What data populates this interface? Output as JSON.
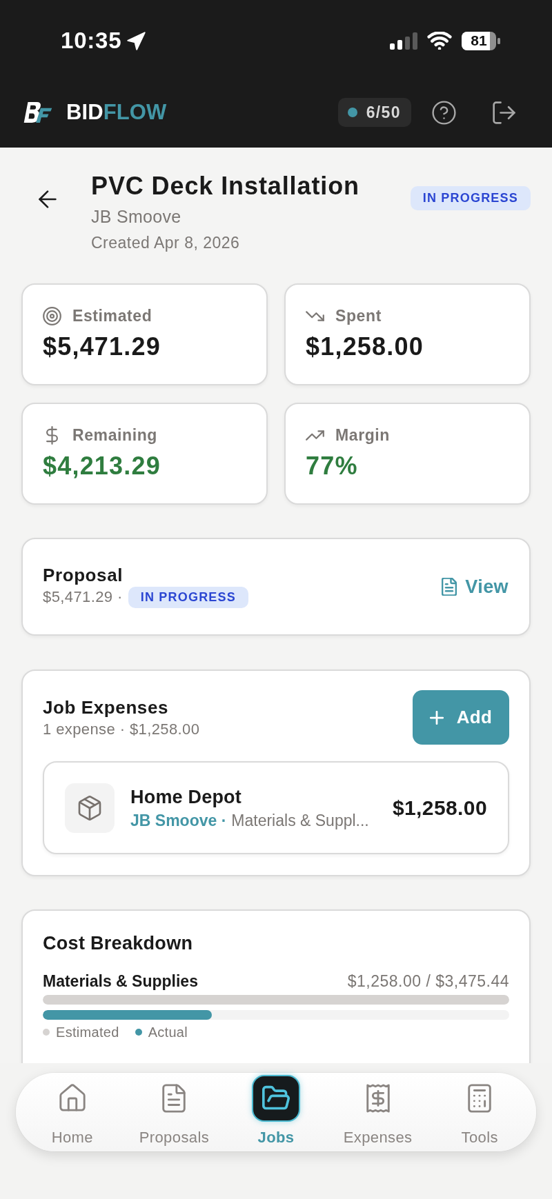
{
  "status_bar": {
    "time": "10:35",
    "battery": "81"
  },
  "header": {
    "brand": {
      "primary": "BID",
      "accent": "FLOW"
    },
    "usage": "6/50"
  },
  "job": {
    "title": "PVC Deck Installation",
    "client": "JB Smoove",
    "created": "Created Apr 8, 2026",
    "status": "IN PROGRESS"
  },
  "stats": [
    {
      "kind": "target",
      "label": "Estimated",
      "value": "$5,471.29",
      "positive": false
    },
    {
      "kind": "trend_down",
      "label": "Spent",
      "value": "$1,258.00",
      "positive": false
    },
    {
      "kind": "dollar",
      "label": "Remaining",
      "value": "$4,213.29",
      "positive": true
    },
    {
      "kind": "trend_up",
      "label": "Margin",
      "value": "77%",
      "positive": true
    }
  ],
  "proposal": {
    "title": "Proposal",
    "amount": "$5,471.29",
    "separator": "·",
    "status": "IN PROGRESS",
    "action": "View"
  },
  "expenses": {
    "title": "Job Expenses",
    "summary": "1 expense · $1,258.00",
    "add_label": "Add",
    "items": [
      {
        "vendor": "Home Depot",
        "client": "JB Smoove",
        "separator": "·",
        "category": "Materials & Suppl...",
        "amount": "$1,258.00"
      }
    ]
  },
  "cost_breakdown": {
    "title": "Cost Breakdown",
    "categories": [
      {
        "name": "Materials & Supplies",
        "amounts": "$1,258.00 / $3,475.44",
        "bars": [
          {
            "level": 1
          },
          {
            "level": 0.362
          }
        ]
      }
    ],
    "legend": [
      {
        "label": "Estimated",
        "color": "#d6d3d1"
      },
      {
        "label": "Actual",
        "color": "#4396a6"
      }
    ]
  },
  "nav": {
    "tabs": [
      {
        "kind": "home",
        "label": "Home",
        "selected": false
      },
      {
        "kind": "proposals",
        "label": "Proposals",
        "selected": false
      },
      {
        "kind": "jobs",
        "label": "Jobs",
        "selected": true
      },
      {
        "kind": "expenses",
        "label": "Expenses",
        "selected": false
      },
      {
        "kind": "tools",
        "label": "Tools",
        "selected": false
      }
    ]
  }
}
